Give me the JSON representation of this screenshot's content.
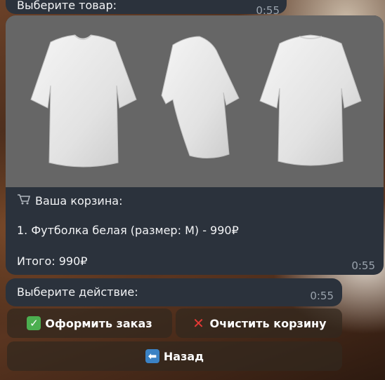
{
  "messages": {
    "top": {
      "text": "Выберите товар:",
      "time": "0:55"
    },
    "cart": {
      "header": "Ваша корзина:",
      "item": "1. Футболка белая (размер: M) - 990₽",
      "total": "Итого: 990₽",
      "time": "0:55"
    },
    "action": {
      "text": "Выберите действие:",
      "time": "0:55"
    }
  },
  "keyboard": {
    "checkout_label": "Оформить заказ",
    "clear_label": "Очистить корзину",
    "back_label": "Назад"
  },
  "icons": {
    "cart": "shopping-cart-icon",
    "check": "check-mark-icon",
    "cross": "cross-mark-icon",
    "back": "back-arrow-icon"
  },
  "colors": {
    "bubble": "#2b323c",
    "check_green": "#4caf50",
    "cross_red": "#e53935",
    "back_blue": "#3b82c4"
  }
}
